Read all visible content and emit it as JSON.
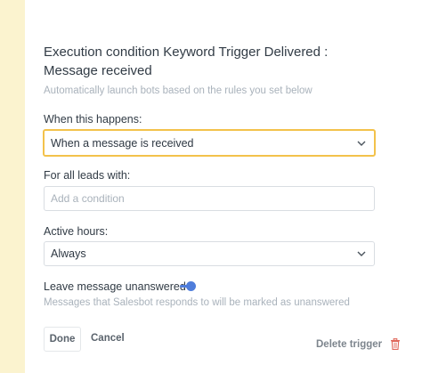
{
  "trigger": {
    "title": "Execution condition Keyword Trigger Delivered : Message received",
    "subtitle": "Automatically launch bots based on the rules you set below"
  },
  "when": {
    "label": "When this happens:",
    "value": "When a message is received"
  },
  "leads": {
    "label": "For all leads with:",
    "placeholder": "Add a condition"
  },
  "hours": {
    "label": "Active hours:",
    "value": "Always"
  },
  "unanswered": {
    "label": "Leave message unanswered",
    "enabled": true,
    "hint": "Messages that Salesbot responds to will be marked as unanswered"
  },
  "actions": {
    "done_label": "Done",
    "cancel_label": "Cancel",
    "delete_label": "Delete trigger"
  },
  "colors": {
    "background": "#fbf3cf",
    "focus_border": "#f3c24b",
    "toggle_accent": "#4f7ddb",
    "delete_icon": "#e0675a"
  },
  "icons": {
    "dropdown": "chevron-down-icon",
    "delete": "trash-icon"
  }
}
